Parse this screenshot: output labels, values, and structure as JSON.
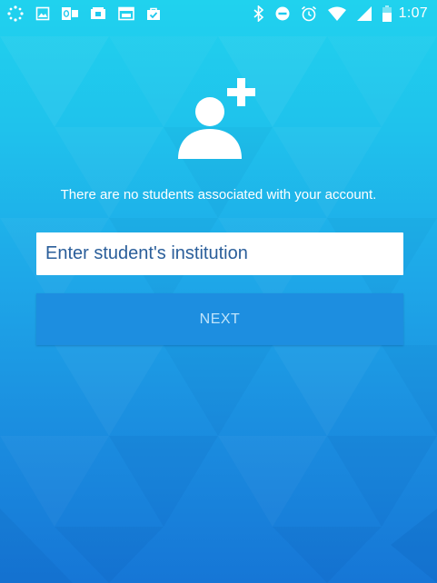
{
  "status_bar": {
    "left_icons": [
      "canvas-app-icon",
      "image-icon",
      "outlook-icon",
      "wallet-icon",
      "calendar-icon",
      "shopping-bag-icon"
    ],
    "right_icons": [
      "bluetooth-icon",
      "do-not-disturb-icon",
      "alarm-icon",
      "wifi-icon",
      "cellular-signal-icon",
      "battery-icon"
    ],
    "time": "1:07"
  },
  "main": {
    "icon": "add-user-icon",
    "empty_message": "There are no students associated with your account.",
    "institution_input": {
      "value": "",
      "placeholder": "Enter student's institution"
    },
    "next_label": "NEXT"
  },
  "colors": {
    "background_top": "#20d2ee",
    "background_bottom": "#1676d6",
    "button_fill": "#1d8ee0",
    "button_text": "#bfe4fb",
    "input_text": "#2a5e9a"
  }
}
